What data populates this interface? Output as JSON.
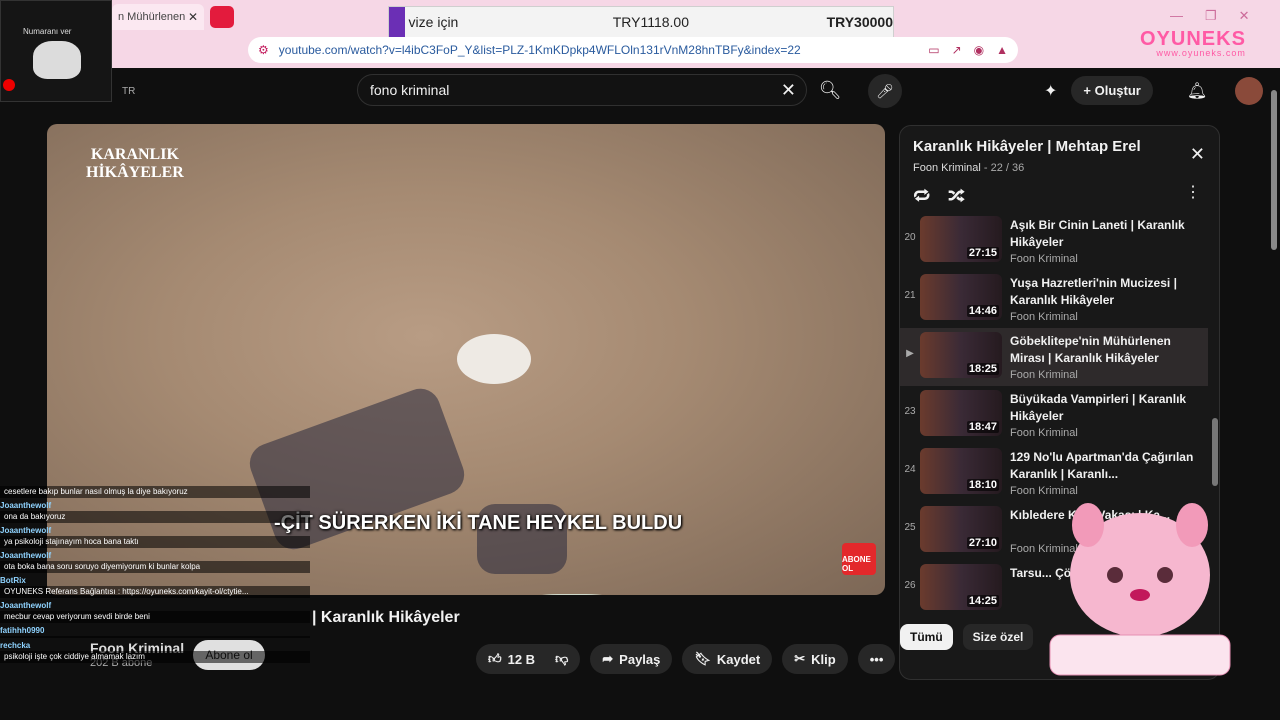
{
  "browser": {
    "tab_title": "n Mühürlenen",
    "url": "youtube.com/watch?v=l4ibC3FoP_Y&list=PLZ-1KmKDpkp4WFLOln131rVnM28hnTBFy&index=22",
    "banner": {
      "left": "vize için",
      "middle": "TRY1118.00",
      "right": "TRY30000"
    },
    "brand_name": "OYUNEKS",
    "brand_site": "www.oyuneks.com",
    "camera_label": "Numaranı ver"
  },
  "yt": {
    "region": "TR",
    "search_value": "fono kriminal",
    "create_label": "Oluştur"
  },
  "video": {
    "logo_line1": "KARANLIK",
    "logo_line2": "HİKÂYELER",
    "subtitle": "-ÇİT SÜRERKEN İKİ TANE HEYKEL BULDU",
    "corner_label": "ABONE OL",
    "title": "Göbeklitepe'nin Mühürlenen Mirası | Karanlık Hikâyeler",
    "title_visible": "| Karanlık Hikâyeler",
    "channel": "Foon Kriminal",
    "subscribers": "202 B abone",
    "subscribe_label": "Abone ol",
    "like_count": "12 B",
    "share_label": "Paylaş",
    "save_label": "Kaydet",
    "clip_label": "Klip"
  },
  "playlist": {
    "title": "Karanlık Hikâyeler | Mehtap Erel",
    "channel": "Foon Kriminal",
    "position": "- 22 / 36",
    "items": [
      {
        "index": "20",
        "title": "Aşık Bir Cinin Laneti | Karanlık Hikâyeler",
        "channel": "Foon Kriminal",
        "duration": "27:15"
      },
      {
        "index": "21",
        "title": "Yuşa Hazretleri'nin Mucizesi | Karanlık Hikâyeler",
        "channel": "Foon Kriminal",
        "duration": "14:46"
      },
      {
        "index": "▶",
        "title": "Göbeklitepe'nin Mühürlenen Mirası | Karanlık Hikâyeler",
        "channel": "Foon Kriminal",
        "duration": "18:25",
        "active": true
      },
      {
        "index": "23",
        "title": "Büyükada Vampirleri | Karanlık Hikâyeler",
        "channel": "Foon Kriminal",
        "duration": "18:47"
      },
      {
        "index": "24",
        "title": "129 No'lu Apartman'da Çağırılan Karanlık | Karanlı...",
        "channel": "Foon Kriminal",
        "duration": "18:10"
      },
      {
        "index": "25",
        "title": "Kıbledere Kö... Vakası | Ka...",
        "channel": "Foon Kriminal",
        "duration": "27:10"
      },
      {
        "index": "26",
        "title": "Tarsu... Çözü...",
        "channel": "",
        "duration": "14:25"
      }
    ]
  },
  "chips": {
    "all": "Tümü",
    "for_you": "Size özel"
  },
  "chat": [
    {
      "user": "",
      "text": "cesetlere bakıp bunlar nasıl olmuş la diye bakıyoruz"
    },
    {
      "user": "Joaanthewolf",
      "text": "ona da bakıyoruz"
    },
    {
      "user": "Joaanthewolf",
      "text": "ya psikoloji stajınayım hoca bana taktı"
    },
    {
      "user": "Joaanthewolf",
      "text": "ota boka bana soru soruyo diyemiyorum ki bunlar kolpa"
    },
    {
      "user": "BotRix",
      "text": "OYUNEKS Referans Bağlantısı : https://oyuneks.com/kayit-ol/ctytie..."
    },
    {
      "user": "Joaanthewolf",
      "text": "mecbur cevap veriyorum sevdi birde beni"
    },
    {
      "user": "fatihhh0990",
      "text": ""
    },
    {
      "user": "rechcka",
      "text": "psikoloji işte çok ciddiye almamak lazım"
    }
  ]
}
